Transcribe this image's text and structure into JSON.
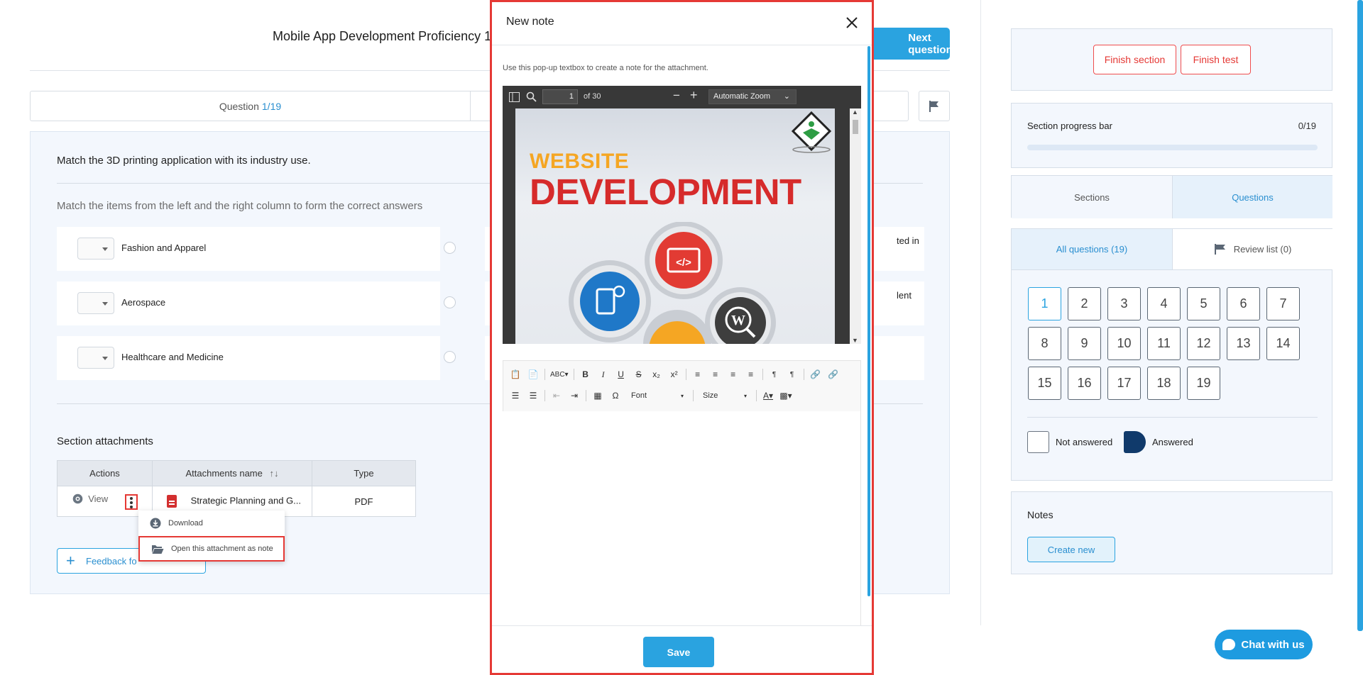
{
  "test": {
    "title": "Mobile App Development Proficiency 1",
    "next_label": "Next question"
  },
  "question_bar": {
    "prefix": "Question",
    "counter": "1/19"
  },
  "question": {
    "text": "Match the 3D printing application with its industry use.",
    "instruction": "Match the items from the left and the right column to form the correct answers",
    "left_items": [
      "Fashion and Apparel",
      "Aerospace",
      "Healthcare and Medicine"
    ],
    "right_items": [
      "ted in",
      "lent",
      ""
    ]
  },
  "attachments": {
    "heading": "Section attachments",
    "columns": [
      "Actions",
      "Attachments name",
      "Type"
    ],
    "sort_icon": "sort-arrows-icon",
    "rows": [
      {
        "action": "View",
        "name": "Strategic Planning and G...",
        "type": "PDF"
      }
    ],
    "menu": {
      "download": "Download",
      "open_note": "Open this attachment as note"
    },
    "feedback_label": "Feedback fo"
  },
  "sidebar": {
    "finish_section": "Finish section",
    "finish_test": "Finish test",
    "progress_label": "Section progress bar",
    "progress_count": "0/19",
    "progress_fraction": 0,
    "tabs": [
      "Sections",
      "Questions"
    ],
    "subtabs": [
      "All questions (19)",
      "Review list (0)"
    ],
    "numbers": [
      "1",
      "2",
      "3",
      "4",
      "5",
      "6",
      "7",
      "8",
      "9",
      "10",
      "11",
      "12",
      "13",
      "14",
      "15",
      "16",
      "17",
      "18",
      "19"
    ],
    "legend_not_answered": "Not answered",
    "legend_answered": "Answered",
    "notes_title": "Notes",
    "create_new": "Create new"
  },
  "chat": {
    "label": "Chat with us"
  },
  "modal": {
    "title": "New note",
    "hint": "Use this pop-up textbox to create a note for the attachment.",
    "pdf": {
      "page": "1",
      "of": "of 30",
      "zoom": "Automatic Zoom",
      "title_line1": "WEBSITE",
      "title_line2": "DEVELOPMENT",
      "gear_code": "</>",
      "gear_wp": "W"
    },
    "editor": {
      "font": "Font",
      "size": "Size"
    },
    "save": "Save"
  },
  "colors": {
    "accent": "#2aa3e0",
    "danger": "#e53935",
    "answered": "#103a6b"
  }
}
